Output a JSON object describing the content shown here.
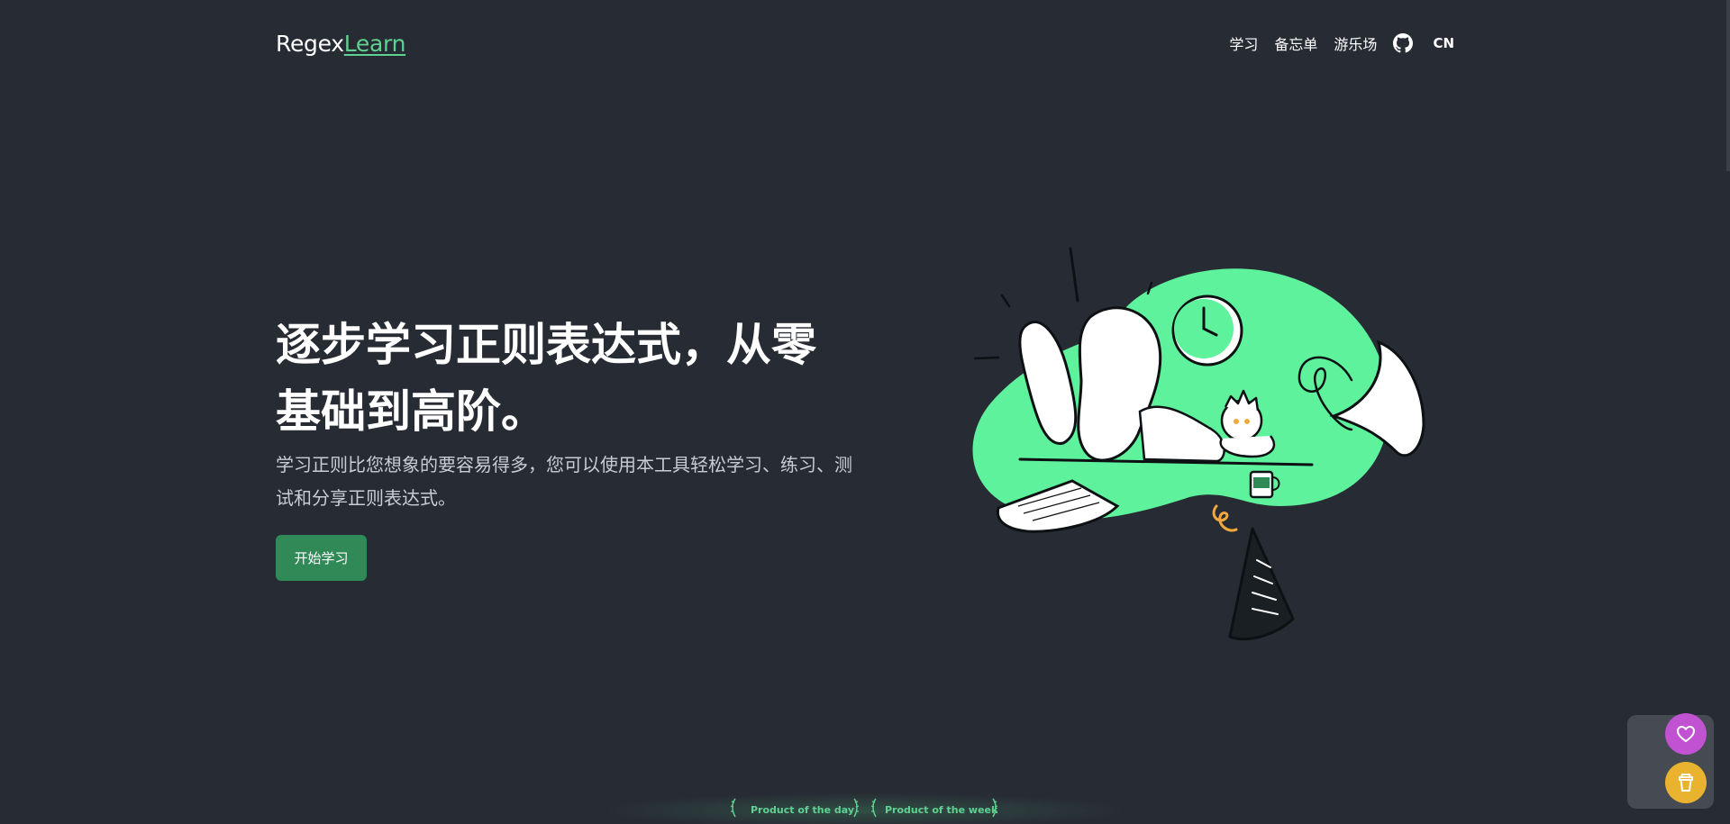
{
  "header": {
    "logo_regex": "Regex",
    "logo_learn": "Learn",
    "nav": [
      {
        "label": "学习"
      },
      {
        "label": "备忘单"
      },
      {
        "label": "游乐场"
      }
    ],
    "github_icon": "github-icon",
    "language": "CN"
  },
  "hero": {
    "title": "逐步学习正则表达式，从零基础到高阶。",
    "description": "学习正则比您想象的要容易得多，您可以使用本工具轻松学习、练习、测试和分享正则表达式。",
    "cta_label": "开始学习"
  },
  "badges": [
    {
      "label": "Product of the day"
    },
    {
      "label": "Product of the week"
    }
  ],
  "floating": {
    "heart_icon": "heart-icon",
    "cup_icon": "coffee-cup-icon"
  },
  "colors": {
    "background": "#272b33",
    "accent": "#5fd191",
    "button": "#2f8a57",
    "blob": "#5ef29c",
    "heart_fab": "#c152d1",
    "cup_fab": "#e9b32f"
  }
}
